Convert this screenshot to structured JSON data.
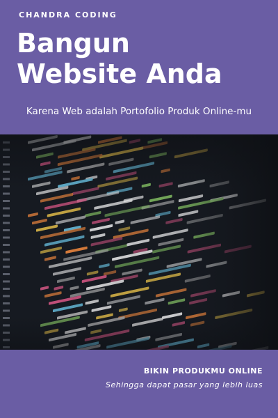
{
  "header": {
    "brand": "CHANDRA CODING",
    "headline_line1": "Bangun",
    "headline_line2": "Website Anda",
    "tagline": "Karena Web adalah Portofolio Produk Online-mu"
  },
  "footer": {
    "title": "BIKIN PRODUKMU ONLINE",
    "subtitle": "Sehingga dapat pasar yang lebih luas"
  },
  "photo": {
    "description_icon": "code-screen-photo"
  },
  "colors": {
    "background": "#6a5da4",
    "text": "#ffffff",
    "photo_bg": "#14171d"
  }
}
